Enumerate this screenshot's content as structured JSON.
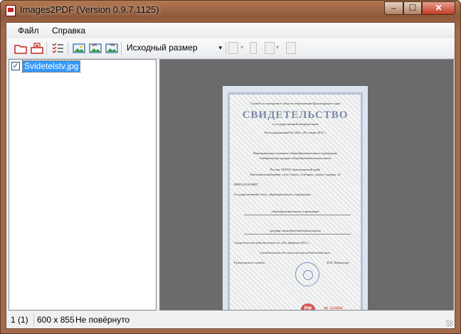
{
  "window": {
    "title": "Images2PDF (Version 0.9.7.1125)",
    "controls": {
      "minimize": "‒",
      "maximize": "☐",
      "close": "✕"
    }
  },
  "menu": [
    "Файл",
    "Справка"
  ],
  "toolbar": {
    "buttons": [
      "open-folder-icon",
      "remove-image-icon",
      "checklist-icon",
      "image-icon",
      "image-rotate-left-icon",
      "image-rotate-right-icon"
    ],
    "size_select": {
      "value": "Исходный размер",
      "arrow": "▾"
    }
  },
  "file_list": [
    {
      "checked": true,
      "name": "Svidetelstv.jpg"
    }
  ],
  "certificate": {
    "header": "Служба по контролю в области образования Красноярского края",
    "title": "СВИДЕТЕЛЬСТВО",
    "subtitle": "о государственной аккредитации",
    "reg_line": "Регистрационный № 2564  «20» июня 2011 г.",
    "org_type": "Муниципальное казенное общеобразовательное учреждение",
    "org_name": "Сибирьевская средняя общеобразовательная школа",
    "address1": "Россия, 663035, Красноярский край,",
    "address2": "Емельяновский район, село Совхоз «Сибирь», улица Садовая, 16",
    "ogrn": "ИНН 2411010087",
    "status": "Государственный статус образовательного учреждения",
    "kind": "общеобразовательное учреждение",
    "type": "средняя общеобразовательная школа",
    "valid": "Свидетельство действительно по «05» февраля 2012 г.",
    "note": "Свидетельство без приложения недействительно.",
    "signer_role": "Руководитель службы",
    "signer_name": "В.П. Шмальорп",
    "rf": "РФ",
    "serial": "08 019886"
  },
  "status_bar": {
    "index": "1 (1)",
    "dimensions": "600 x 855",
    "rotation": "Не повёрнуто"
  }
}
